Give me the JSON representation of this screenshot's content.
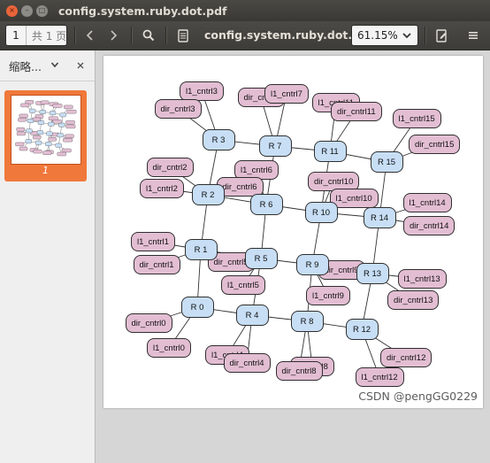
{
  "window": {
    "title": "config.system.ruby.dot.pdf",
    "close_glyph": "×",
    "min_glyph": "–",
    "max_glyph": "□"
  },
  "toolbar": {
    "page_current": "1",
    "page_total": "共 1 页",
    "prev_icon": "chevron-left-icon",
    "next_icon": "chevron-right-icon",
    "search_icon": "search-icon",
    "doc_properties_icon": "document-icon",
    "doc_title": "config.system.ruby.dot.pdf",
    "zoom_value": "61.15%",
    "annotate_icon": "annotate-icon",
    "menu_icon": "hamburger-menu-icon"
  },
  "sidebar": {
    "heading": "缩略...",
    "thumbnail_label": "1"
  },
  "graph": {
    "routers": [
      "R 0",
      "R 1",
      "R 2",
      "R 3",
      "R 4",
      "R 5",
      "R 6",
      "R 7",
      "R 8",
      "R 9",
      "R 10",
      "R 11",
      "R 12",
      "R 13",
      "R 14",
      "R 15"
    ],
    "nodes": [
      {
        "id": "l1_cntrl3",
        "label": "l1_cntrl3"
      },
      {
        "id": "dir_cntrl3",
        "label": "dir_cntrl3"
      },
      {
        "id": "dir_cntrl7",
        "label": "dir_cntrl7"
      },
      {
        "id": "l1_cntrl7",
        "label": "l1_cntrl7"
      },
      {
        "id": "l1_cntrl11",
        "label": "l1_cntrl11"
      },
      {
        "id": "dir_cntrl11",
        "label": "dir_cntrl11"
      },
      {
        "id": "l1_cntrl15",
        "label": "l1_cntrl15"
      },
      {
        "id": "dir_cntrl15",
        "label": "dir_cntrl15"
      },
      {
        "id": "dir_cntrl2",
        "label": "dir_cntrl2"
      },
      {
        "id": "l1_cntrl2",
        "label": "l1_cntrl2"
      },
      {
        "id": "l1_cntrl6",
        "label": "l1_cntrl6"
      },
      {
        "id": "dir_cntrl6",
        "label": "dir_cntrl6"
      },
      {
        "id": "dir_cntrl10",
        "label": "dir_cntrl10"
      },
      {
        "id": "l1_cntrl10",
        "label": "l1_cntrl10"
      },
      {
        "id": "l1_cntrl14",
        "label": "l1_cntrl14"
      },
      {
        "id": "dir_cntrl14",
        "label": "dir_cntrl14"
      },
      {
        "id": "l1_cntrl1",
        "label": "l1_cntrl1"
      },
      {
        "id": "dir_cntrl1",
        "label": "dir_cntrl1"
      },
      {
        "id": "dir_cntrl5",
        "label": "dir_cntrl5"
      },
      {
        "id": "l1_cntrl5",
        "label": "l1_cntrl5"
      },
      {
        "id": "dir_cntrl9",
        "label": "dir_cntrl9"
      },
      {
        "id": "l1_cntrl9",
        "label": "l1_cntrl9"
      },
      {
        "id": "l1_cntrl13",
        "label": "l1_cntrl13"
      },
      {
        "id": "dir_cntrl13",
        "label": "dir_cntrl13"
      },
      {
        "id": "dir_cntrl0",
        "label": "dir_cntrl0"
      },
      {
        "id": "l1_cntrl0",
        "label": "l1_cntrl0"
      },
      {
        "id": "l1_cntrl4",
        "label": "l1_cntrl4"
      },
      {
        "id": "dir_cntrl4",
        "label": "dir_cntrl4"
      },
      {
        "id": "l1_cntrl8",
        "label": "l1_cntrl8"
      },
      {
        "id": "dir_cntrl8",
        "label": "dir_cntrl8"
      },
      {
        "id": "dir_cntrl12",
        "label": "dir_cntrl12"
      },
      {
        "id": "l1_cntrl12",
        "label": "l1_cntrl12"
      }
    ]
  },
  "watermark": "CSDN @pengGG0229",
  "colors": {
    "router_fill": "#c7def5",
    "controller_fill": "#e3bed3",
    "thumbnail_highlight": "#f0783b",
    "titlebar_close": "#e9643a"
  }
}
